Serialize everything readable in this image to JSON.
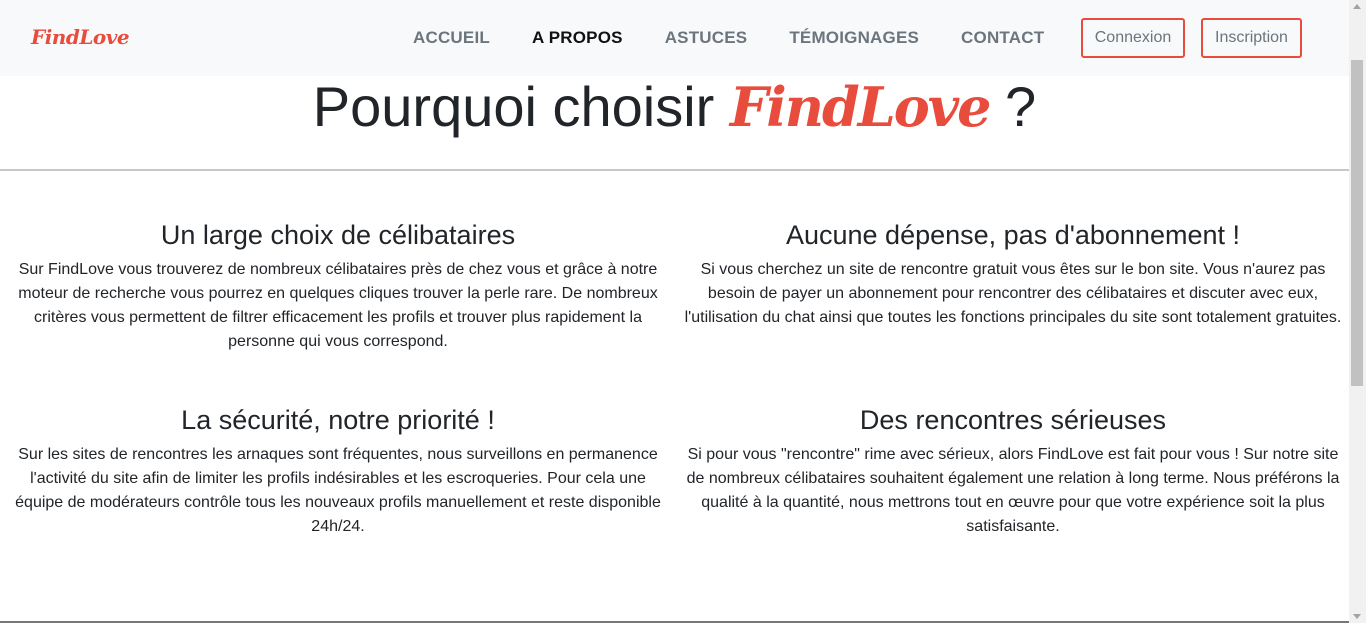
{
  "header": {
    "brand": "FindLove",
    "nav": [
      {
        "label": "ACCUEIL",
        "active": false
      },
      {
        "label": "A PROPOS",
        "active": true
      },
      {
        "label": "ASTUCES",
        "active": false
      },
      {
        "label": "TÉMOIGNAGES",
        "active": false
      },
      {
        "label": "CONTACT",
        "active": false
      }
    ],
    "login_label": "Connexion",
    "signup_label": "Inscription"
  },
  "hero": {
    "title_prefix": "Pourquoi choisir",
    "title_brand": "FindLove",
    "title_suffix": "?"
  },
  "features": [
    {
      "title": "Un large choix de célibataires",
      "text": "Sur FindLove vous trouverez de nombreux célibataires près de chez vous et grâce à notre moteur de recherche vous pourrez en quelques cliques trouver la perle rare. De nombreux critères vous permettent de filtrer efficacement les profils et trouver plus rapidement la personne qui vous correspond."
    },
    {
      "title": "Aucune dépense, pas d'abonnement !",
      "text": "Si vous cherchez un site de rencontre gratuit vous êtes sur le bon site. Vous n'aurez pas besoin de payer un abonnement pour rencontrer des célibataires et discuter avec eux, l'utilisation du chat ainsi que toutes les fonctions principales du site sont totalement gratuites."
    },
    {
      "title": "La sécurité, notre priorité !",
      "text": "Sur les sites de rencontres les arnaques sont fréquentes, nous surveillons en permanence l'activité du site afin de limiter les profils indésirables et les escroqueries. Pour cela une équipe de modérateurs contrôle tous les nouveaux profils manuellement et reste disponible 24h/24."
    },
    {
      "title": "Des rencontres sérieuses",
      "text": "Si pour vous \"rencontre\" rime avec sérieux, alors FindLove est fait pour vous ! Sur notre site de nombreux célibataires souhaitent également une relation à long terme. Nous préférons la qualité à la quantité, nous mettrons tout en œuvre pour que votre expérience soit la plus satisfaisante."
    }
  ],
  "colors": {
    "accent": "#e74c3c",
    "nav_bg": "#f8f9fa",
    "nav_text": "#6c757d",
    "nav_active": "#111111"
  }
}
